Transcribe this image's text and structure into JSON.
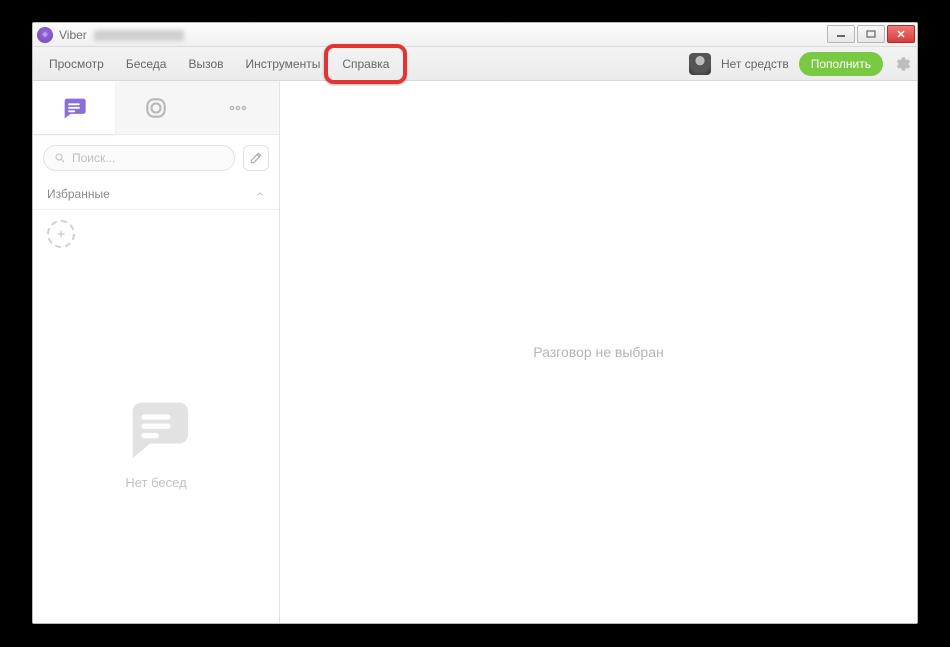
{
  "window": {
    "title_prefix": "Viber"
  },
  "menubar": {
    "items": [
      "Просмотр",
      "Беседа",
      "Вызов",
      "Инструменты",
      "Справка"
    ],
    "highlighted_index": 4,
    "balance_text": "Нет средств",
    "topup_label": "Пополнить"
  },
  "sidebar": {
    "tabs": {
      "chats_icon": "chats",
      "public_icon": "public",
      "more_icon": "more"
    },
    "search_placeholder": "Поиск...",
    "favorites_header": "Избранные",
    "empty_label": "Нет бесед"
  },
  "main": {
    "empty_text": "Разговор не выбран"
  }
}
